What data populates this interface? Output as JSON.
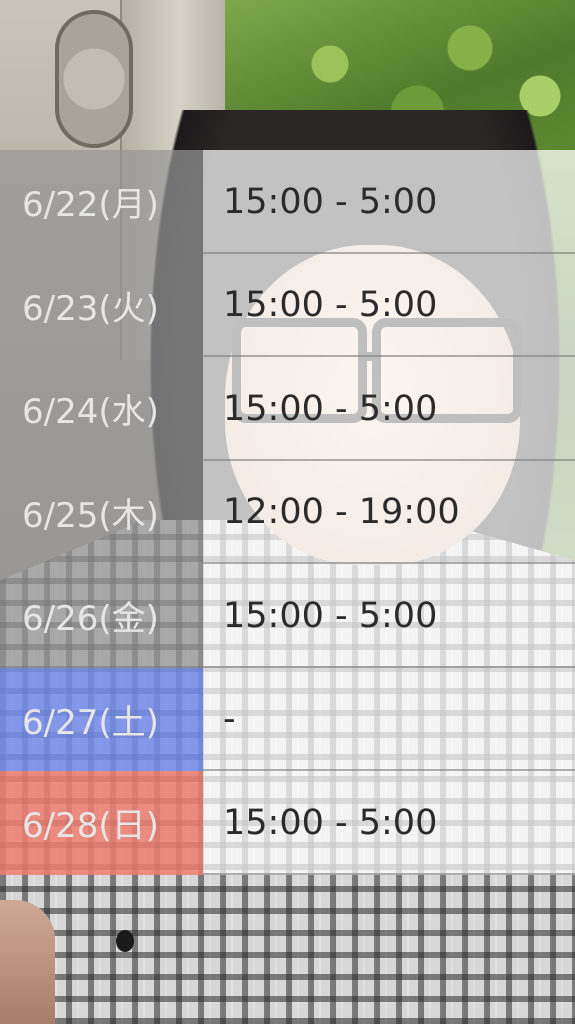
{
  "schedule": {
    "rows": [
      {
        "date": "6/22(月)",
        "time": "15:00 - 5:00",
        "day_type": "weekday"
      },
      {
        "date": "6/23(火)",
        "time": "15:00 - 5:00",
        "day_type": "weekday"
      },
      {
        "date": "6/24(水)",
        "time": "15:00 - 5:00",
        "day_type": "weekday"
      },
      {
        "date": "6/25(木)",
        "time": "12:00 - 19:00",
        "day_type": "weekday"
      },
      {
        "date": "6/26(金)",
        "time": "15:00 - 5:00",
        "day_type": "weekday"
      },
      {
        "date": "6/27(土)",
        "time": "-",
        "day_type": "saturday"
      },
      {
        "date": "6/28(日)",
        "time": "15:00 - 5:00",
        "day_type": "sunday"
      }
    ]
  },
  "colors": {
    "weekday_cell": "#969696",
    "saturday_cell": "#738ceb",
    "sunday_cell": "#ee7d6e",
    "time_cell": "#ffffff",
    "time_text": "#2b2b2b",
    "date_text": "#e6e6e6"
  }
}
